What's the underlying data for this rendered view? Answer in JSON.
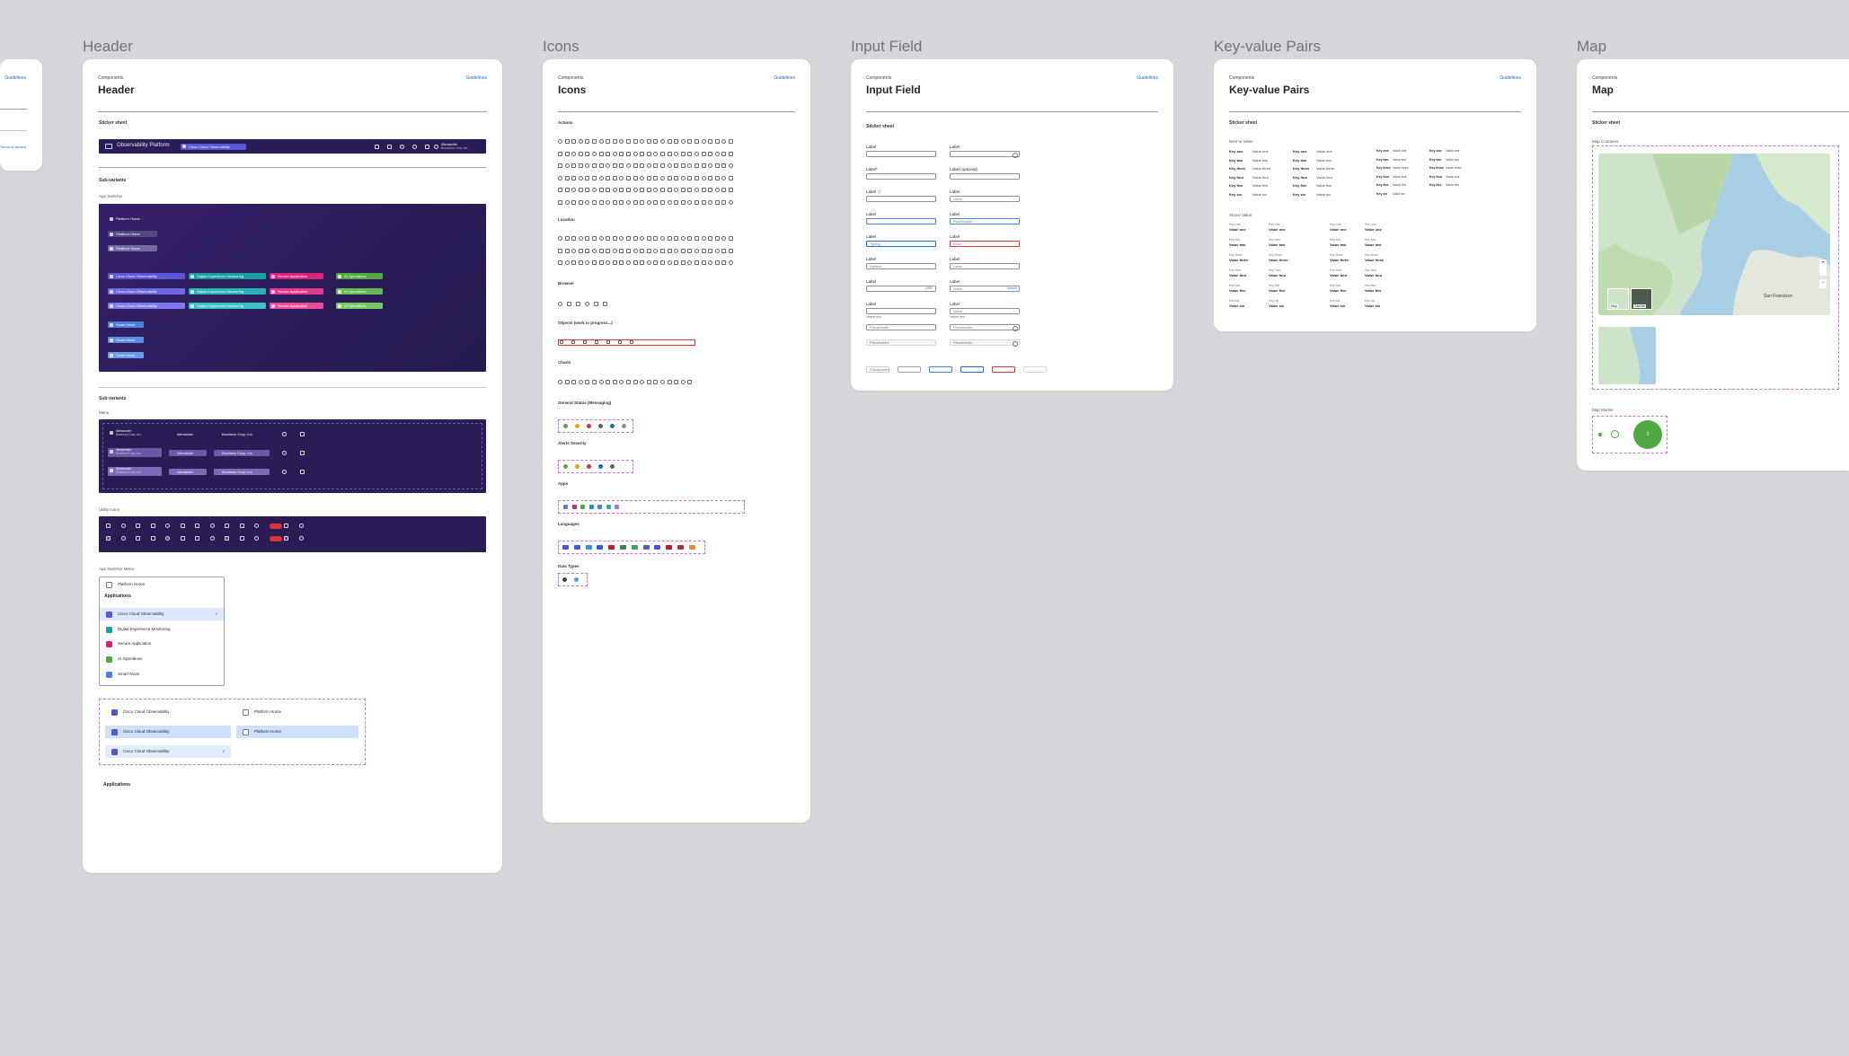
{
  "colors": {
    "canvas": "#d4d6da",
    "dark_bar": "#2a1d55",
    "observability": "#5b56d6",
    "experience": "#1b9ea3",
    "security": "#d6247a",
    "aiops": "#52a843",
    "accent": "#1d69cc",
    "error": "#e0303a"
  },
  "leftcard": {
    "guide": "Guidelines",
    "link": "Terms of service"
  },
  "header": {
    "frame": "Header",
    "crumb": "Components",
    "title": "Header",
    "guide": "Guidelines",
    "sticker": "Sticker sheet",
    "bar": {
      "product": "Observability Platform",
      "app": "Cisco Cloud Observability",
      "user": "Alexander",
      "company": "Business Corp, Inc."
    },
    "subvariants": "Sub-variants",
    "appswitcher": "App Switcher",
    "platform_home": "Platform Home",
    "apps": [
      "Cisco Cloud Observability",
      "Digital Experience Monitoring",
      "Secure Application",
      "AI Operations"
    ],
    "smartkeh": "Smart Noob",
    "subvariants2": "Sub-variants",
    "menu": "Menu",
    "menu_user": "Alexander",
    "menu_company": "Business Corp, Inc.",
    "utility": "Utility Icons",
    "appmenu": "App Switcher Menu",
    "appmenu_items": {
      "home": "Platform Home",
      "apps_title": "Applications",
      "list": [
        "Cisco Cloud Observability",
        "Digital Experience Monitoring",
        "Secure Application",
        "AI Operations",
        "Smart Noob"
      ]
    },
    "opts": {
      "obs": "Cisco Cloud Observability",
      "home": "Platform Home"
    },
    "applications": "Applications"
  },
  "icons": {
    "frame": "Icons",
    "crumb": "Components",
    "title": "Icons",
    "guide": "Guidelines",
    "sections": [
      "Actions",
      "Location",
      "Browser",
      "Objects (work in progress...)",
      "Charts",
      "General Status (Messaging)",
      "Alerts Severity",
      "Apps",
      "Languages",
      "Data Types"
    ]
  },
  "input": {
    "frame": "Input Field",
    "crumb": "Components",
    "title": "Input Field",
    "guide": "Guidelines",
    "sticker": "Sticker sheet",
    "label": "Label",
    "label_req": "Label*",
    "label_opt": "Label (optional)",
    "label_info": "Label ⓘ",
    "value": "Value",
    "placeholder": "Placeholder",
    "typing": "Typing",
    "error": "Error",
    "default_value": "Default",
    "helper": "Helper text",
    "currency": "USD",
    "search": "Search",
    "clear": "Clear"
  },
  "kvp": {
    "frame": "Key-value Pairs",
    "crumb": "Components",
    "title": "Key-value Pairs",
    "guide": "Guidelines",
    "sticker": "Sticker sheet",
    "left_to_right": "Next to Value",
    "above": "Above Value",
    "keys": [
      "Key one",
      "Key two",
      "Key three",
      "Key four",
      "Key five",
      "Key six"
    ],
    "values": [
      "Value one",
      "Value two",
      "Value three",
      "Value four",
      "Value five",
      "Value six"
    ]
  },
  "map": {
    "frame": "Map",
    "crumb": "Components",
    "title": "Map",
    "guide": "Guidelines",
    "sticker": "Sticker sheet",
    "container": "Map Container",
    "city": "San Francisco",
    "map_label": "Map",
    "sat_label": "Satellite",
    "marker": "Map Marker",
    "marker_text": "3"
  }
}
